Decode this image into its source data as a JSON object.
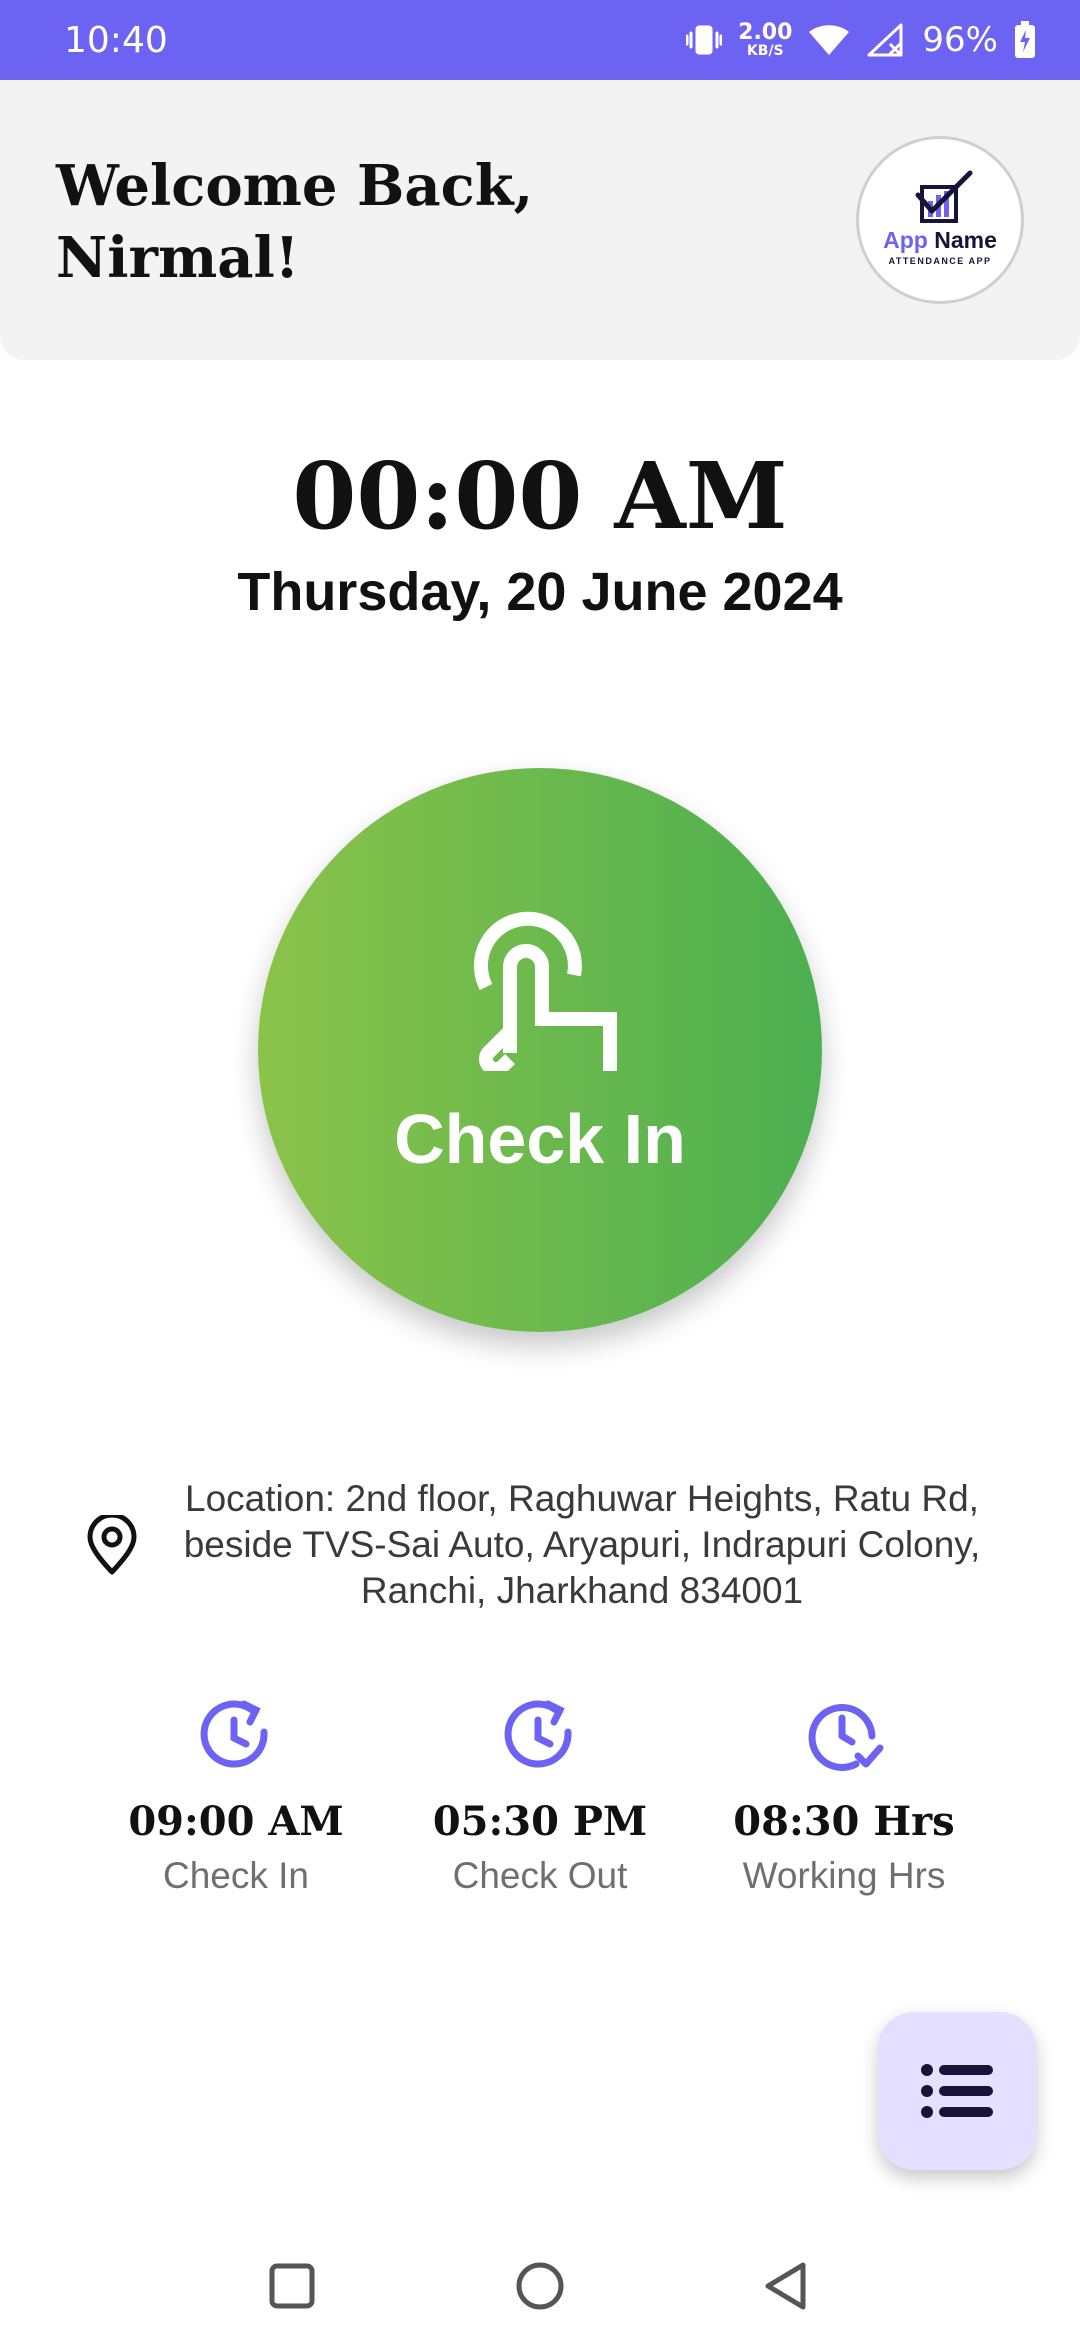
{
  "status_bar": {
    "time": "10:40",
    "net_speed_value": "2.00",
    "net_speed_unit": "KB/S",
    "battery": "96%",
    "icons": [
      "vibrate-icon",
      "wifi-icon",
      "signal-icon",
      "battery-charging-icon"
    ]
  },
  "header": {
    "welcome_line1": "Welcome Back,",
    "welcome_line2": "Nirmal!",
    "logo": {
      "app": "App",
      "name": "Name",
      "subtitle": "ATTENDANCE APP"
    }
  },
  "clock": {
    "time": "00:00 AM",
    "date": "Thursday, 20 June 2024"
  },
  "check_in_button": {
    "label": "Check In",
    "icon": "tap-hand-icon"
  },
  "location": {
    "icon": "location-pin-icon",
    "text_line1": "Location: 2nd floor, Raghuwar Heights, Ratu Rd,",
    "text_line2": "beside TVS-Sai Auto, Aryapuri, Indrapuri Colony,",
    "text_line3": "Ranchi, Jharkhand 834001"
  },
  "stats": [
    {
      "icon": "clock-check-in-icon",
      "value": "09:00 AM",
      "label": "Check In"
    },
    {
      "icon": "clock-check-out-icon",
      "value": "05:30 PM",
      "label": "Check Out"
    },
    {
      "icon": "clock-check-icon",
      "value": "08:30 Hrs",
      "label": "Working Hrs"
    }
  ],
  "fab": {
    "icon": "list-icon"
  },
  "nav": {
    "icons": [
      "recents-square-icon",
      "home-circle-icon",
      "back-triangle-icon"
    ]
  },
  "colors": {
    "status_bar": "#6c63f2",
    "accent": "#6c63f2",
    "header_bg": "#f3f3f3",
    "check_in_gradient_start": "#8bc34a",
    "check_in_gradient_end": "#4caf50",
    "fab_bg": "#e5e0ff",
    "fab_icon": "#17143a"
  }
}
